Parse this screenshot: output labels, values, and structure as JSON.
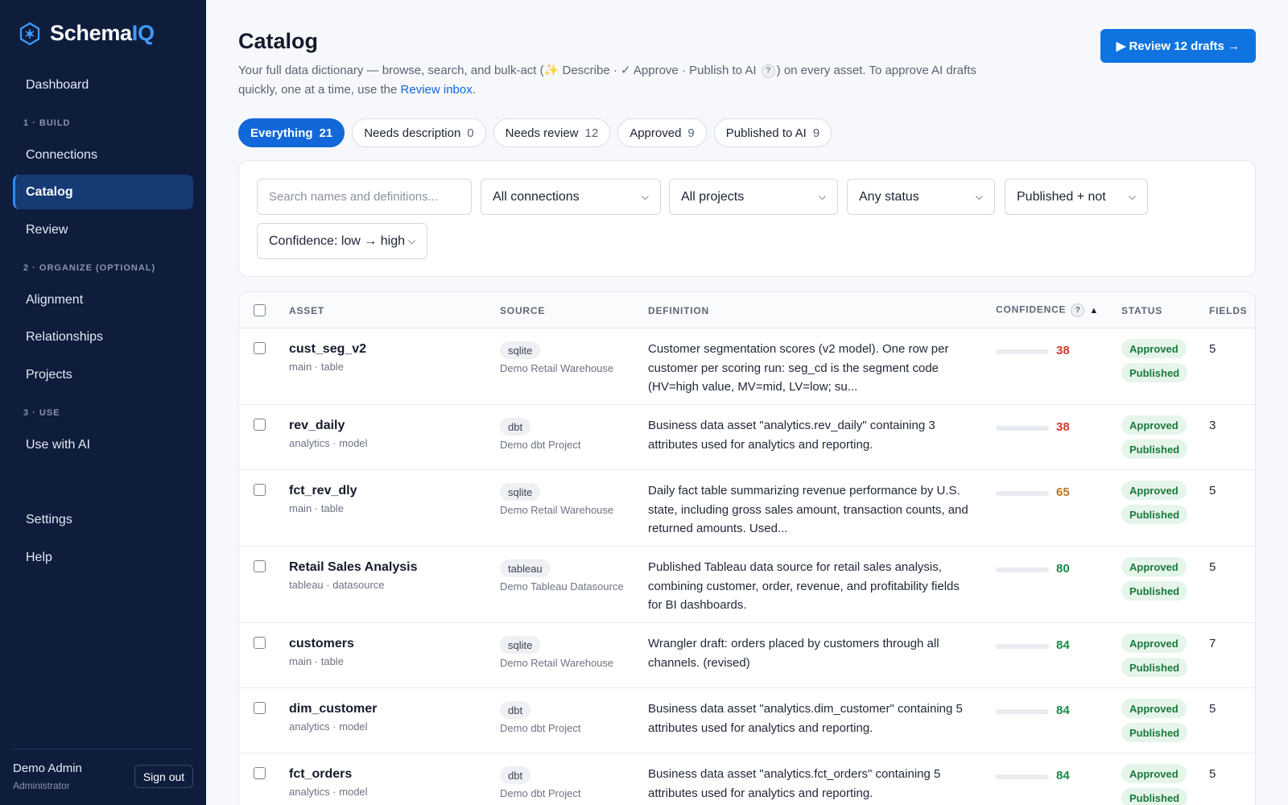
{
  "app": {
    "brand_prefix": "Schema",
    "brand_accent": "IQ"
  },
  "sidebar": {
    "items_top": [
      {
        "label": "Dashboard"
      }
    ],
    "sections": [
      {
        "label": "1 · BUILD",
        "items": [
          {
            "label": "Connections"
          },
          {
            "label": "Catalog",
            "active": true
          },
          {
            "label": "Review"
          }
        ]
      },
      {
        "label": "2 · ORGANIZE (OPTIONAL)",
        "items": [
          {
            "label": "Alignment"
          },
          {
            "label": "Relationships"
          },
          {
            "label": "Projects"
          }
        ]
      },
      {
        "label": "3 · USE",
        "items": [
          {
            "label": "Use with AI"
          }
        ]
      }
    ],
    "items_bottom": [
      {
        "label": "Settings"
      },
      {
        "label": "Help"
      }
    ],
    "user": {
      "name": "Demo Admin",
      "role": "Administrator",
      "signout_label": "Sign out"
    }
  },
  "header": {
    "title": "Catalog",
    "desc_part1": "Your full data dictionary — browse, search, and bulk-act (✨ Describe · ✓ Approve · Publish to AI",
    "desc_help": "?",
    "desc_part2": ") on every asset. To approve AI drafts quickly, one at a time, use the",
    "desc_link": "Review inbox",
    "desc_end": ".",
    "review_button": "▶ Review 12 drafts →"
  },
  "tabs": [
    {
      "label": "Everything",
      "count": "21",
      "active": true
    },
    {
      "label": "Needs description",
      "count": "0"
    },
    {
      "label": "Needs review",
      "count": "12"
    },
    {
      "label": "Approved",
      "count": "9"
    },
    {
      "label": "Published to AI",
      "count": "9"
    }
  ],
  "filters": {
    "search_placeholder": "Search names and definitions...",
    "connections": "All connections",
    "projects": "All projects",
    "status": "Any status",
    "published": "Published + not",
    "confidence": "Confidence: low → high"
  },
  "table": {
    "columns": {
      "asset": "ASSET",
      "source": "SOURCE",
      "definition": "DEFINITION",
      "confidence": "CONFIDENCE",
      "confidence_help": "?",
      "sort": "▲",
      "status": "STATUS",
      "fields": "FIELDS"
    },
    "rows": [
      {
        "name": "cust_seg_v2",
        "sub": "main · table",
        "source_type": "sqlite",
        "source_name": "Demo Retail Warehouse",
        "definition": "Customer segmentation scores (v2 model). One row per customer per scoring run: seg_cd is the segment code (HV=high value, MV=mid, LV=low; su...",
        "confidence": "38",
        "status1": "Approved",
        "status2": "Published",
        "fields": "5"
      },
      {
        "name": "rev_daily",
        "sub": "analytics · model",
        "source_type": "dbt",
        "source_name": "Demo dbt Project",
        "definition": "Business data asset \"analytics.rev_daily\" containing 3 attributes used for analytics and reporting.",
        "confidence": "38",
        "status1": "Approved",
        "status2": "Published",
        "fields": "3"
      },
      {
        "name": "fct_rev_dly",
        "sub": "main · table",
        "source_type": "sqlite",
        "source_name": "Demo Retail Warehouse",
        "definition": "Daily fact table summarizing revenue performance by U.S. state, including gross sales amount, transaction counts, and returned amounts. Used...",
        "confidence": "65",
        "status1": "Approved",
        "status2": "Published",
        "fields": "5"
      },
      {
        "name": "Retail Sales Analysis",
        "sub": "tableau · datasource",
        "source_type": "tableau",
        "source_name": "Demo Tableau Datasource",
        "definition": "Published Tableau data source for retail sales analysis, combining customer, order, revenue, and profitability fields for BI dashboards.",
        "confidence": "80",
        "status1": "Approved",
        "status2": "Published",
        "fields": "5"
      },
      {
        "name": "customers",
        "sub": "main · table",
        "source_type": "sqlite",
        "source_name": "Demo Retail Warehouse",
        "definition": "Wrangler draft: orders placed by customers through all channels. (revised)",
        "confidence": "84",
        "status1": "Approved",
        "status2": "Published",
        "fields": "7"
      },
      {
        "name": "dim_customer",
        "sub": "analytics · model",
        "source_type": "dbt",
        "source_name": "Demo dbt Project",
        "definition": "Business data asset \"analytics.dim_customer\" containing 5 attributes used for analytics and reporting.",
        "confidence": "84",
        "status1": "Approved",
        "status2": "Published",
        "fields": "5"
      },
      {
        "name": "fct_orders",
        "sub": "analytics · model",
        "source_type": "dbt",
        "source_name": "Demo dbt Project",
        "definition": "Business data asset \"analytics.fct_orders\" containing 5 attributes used for analytics and reporting.",
        "confidence": "84",
        "status1": "Approved",
        "status2": "Published",
        "fields": "5"
      }
    ]
  },
  "colors": {
    "conf_low": "#d23b2f",
    "conf_mid": "#b7791f",
    "conf_high": "#1a8a4a"
  },
  "icons": {
    "brand": "hexagon-logo-icon",
    "dropdown": "chevron-down-icon"
  }
}
